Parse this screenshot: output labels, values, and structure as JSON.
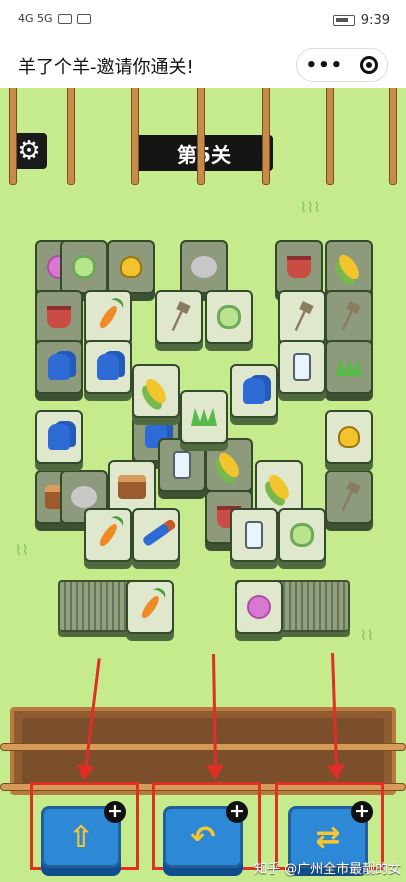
{
  "status": {
    "left_text": "4G 5G",
    "time": "9:39"
  },
  "title_bar": {
    "title": "羊了个羊-邀请你通关!",
    "more_label": "•••"
  },
  "game": {
    "settings_icon": "gear-icon",
    "level_label": "第5关",
    "item_names": [
      "carrot",
      "gloves",
      "corn",
      "grass",
      "cabbage",
      "rake",
      "stump",
      "milk",
      "bell",
      "yarn",
      "brush",
      "bucket",
      "wool"
    ],
    "actions": [
      {
        "name": "move-out",
        "icon": "tray-up-icon"
      },
      {
        "name": "undo",
        "icon": "undo-icon"
      },
      {
        "name": "shuffle",
        "icon": "shuffle-icon"
      }
    ]
  },
  "watermark": "知乎 @广州全市最靓的女",
  "colors": {
    "background": "#c6eb8d",
    "tile": "#dfe8cc",
    "action_button": "#2d88d6",
    "highlight": "#e02f24"
  }
}
